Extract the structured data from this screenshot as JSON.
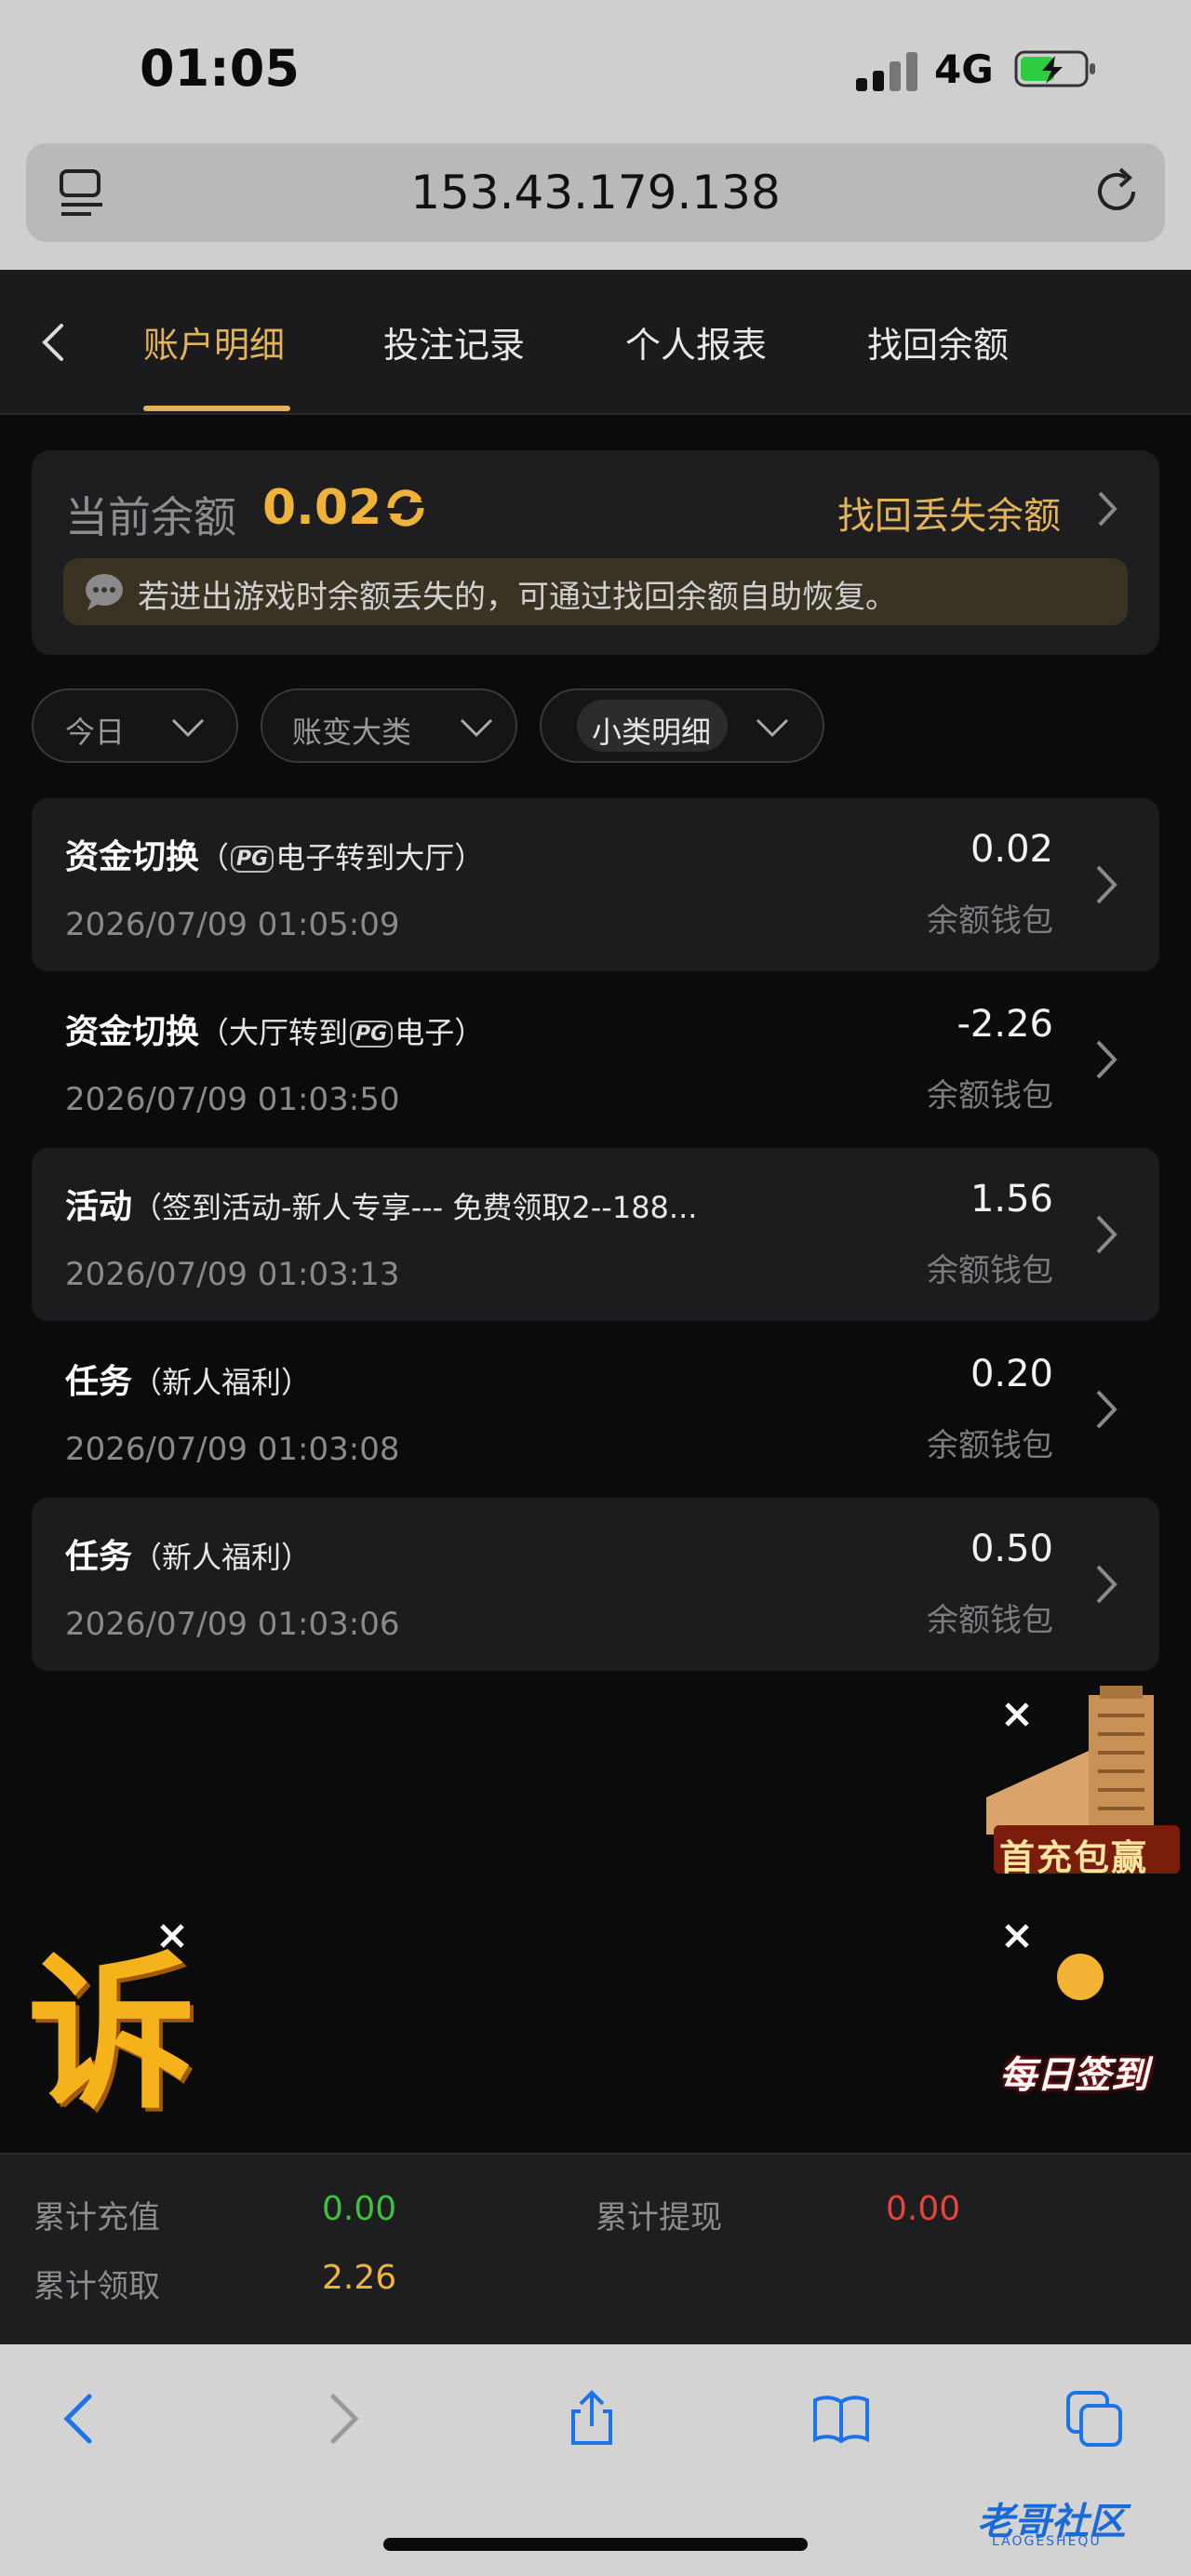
{
  "status_bar": {
    "time": "01:05",
    "network": "4G"
  },
  "browser": {
    "url": "153.43.179.138"
  },
  "header": {
    "tabs": [
      {
        "label": "账户明细",
        "active": true
      },
      {
        "label": "投注记录",
        "active": false
      },
      {
        "label": "个人报表",
        "active": false
      },
      {
        "label": "找回余额",
        "active": false
      }
    ]
  },
  "balance": {
    "label": "当前余额",
    "value": "0.02",
    "recover_link": "找回丢失余额",
    "notice": "若进出游戏时余额丢失的，可通过找回余额自助恢复。"
  },
  "filters": [
    {
      "label": "今日"
    },
    {
      "label": "账变大类"
    },
    {
      "label": "小类明细"
    }
  ],
  "records": [
    {
      "title": "资金切换",
      "sub_pre": "（",
      "pg_before": true,
      "sub_text": "电子转到大厅）",
      "date": "2026/07/09 01:05:09",
      "amount": "0.02",
      "wallet": "余额钱包"
    },
    {
      "title": "资金切换",
      "sub_pre": "（大厅转到",
      "pg_mid": true,
      "sub_text": "电子）",
      "date": "2026/07/09 01:03:50",
      "amount": "-2.26",
      "wallet": "余额钱包"
    },
    {
      "title": "活动",
      "sub_pre": "（签到活动-新人专享--- 免费领取2--188...",
      "date": "2026/07/09 01:03:13",
      "amount": "1.56",
      "wallet": "余额钱包"
    },
    {
      "title": "任务",
      "sub_pre": "（新人福利）",
      "date": "2026/07/09 01:03:08",
      "amount": "0.20",
      "wallet": "余额钱包"
    },
    {
      "title": "任务",
      "sub_pre": "（新人福利）",
      "date": "2026/07/09 01:03:06",
      "amount": "0.50",
      "wallet": "余额钱包"
    }
  ],
  "pg_logo": "PG",
  "promos": {
    "first_deposit": "首充包赢",
    "daily_checkin": "每日签到",
    "complaint_glyph": "诉"
  },
  "totals": {
    "recharge_label": "累计充值",
    "recharge_value": "0.00",
    "withdraw_label": "累计提现",
    "withdraw_value": "0.00",
    "claimed_label": "累计领取",
    "claimed_value": "2.26"
  },
  "watermark": {
    "text": "老哥社区",
    "sub": "LAOGESHEQU"
  },
  "colors": {
    "accent": "#e3b35a",
    "balance": "#f0b33a",
    "recharge": "#3fc13f",
    "withdraw": "#e5453a",
    "claimed": "#f0b33a"
  }
}
